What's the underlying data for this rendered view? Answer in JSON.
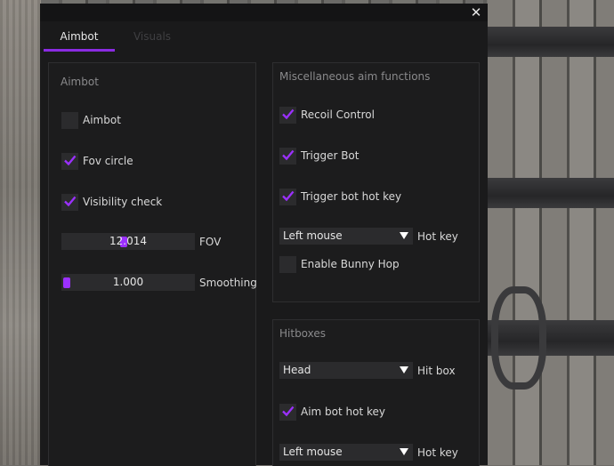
{
  "window": {
    "close_glyph": "✕"
  },
  "tabs": [
    {
      "label": "Aimbot",
      "active": true
    },
    {
      "label": "Visuals",
      "active": false
    }
  ],
  "aimbot_panel": {
    "title": "Aimbot",
    "checkboxes": [
      {
        "label": "Aimbot",
        "checked": false
      },
      {
        "label": "Fov circle",
        "checked": true
      },
      {
        "label": "Visibility check",
        "checked": true
      }
    ],
    "sliders": [
      {
        "label": "FOV",
        "value": "12.014"
      },
      {
        "label": "Smoothing",
        "value": "1.000"
      }
    ]
  },
  "misc_panel": {
    "title": "Miscellaneous aim functions",
    "checkboxes": [
      {
        "label": "Recoil Control",
        "checked": true
      },
      {
        "label": "Trigger Bot",
        "checked": true
      },
      {
        "label": "Trigger bot hot key",
        "checked": true
      }
    ],
    "hotkey_combo": {
      "value": "Left mouse",
      "label": "Hot key"
    },
    "bunny_hop": {
      "label": "Enable Bunny Hop",
      "checked": false
    }
  },
  "hitbox_panel": {
    "title": "Hitboxes",
    "hitbox_combo": {
      "value": "Head",
      "label": "Hit box"
    },
    "aim_hotkey_check": {
      "label": "Aim bot hot key",
      "checked": true
    },
    "hotkey_combo": {
      "value": "Left mouse",
      "label": "Hot key"
    }
  },
  "colors": {
    "accent": "#8a2be2",
    "check": "#9b30ff",
    "widget_bg": "#2b2b2d"
  }
}
